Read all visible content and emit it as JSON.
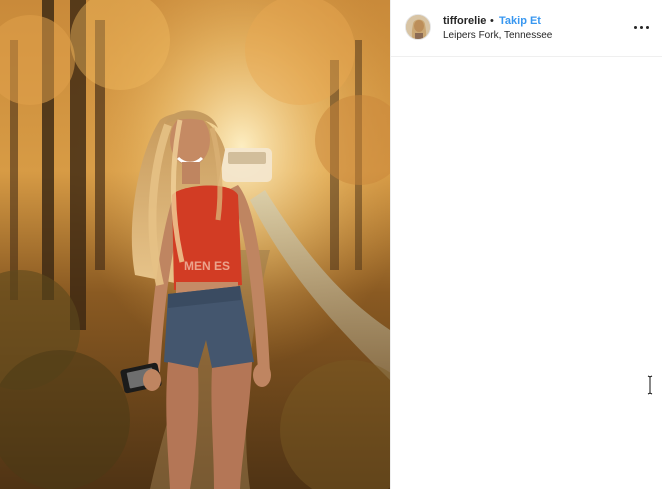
{
  "post": {
    "username": "tifforelie",
    "separator": "•",
    "follow_label": "Takip Et",
    "location": "Leipers Fork, Tennessee"
  },
  "icons": {
    "more": "more-options-icon",
    "text_cursor": "text-cursor-icon"
  },
  "colors": {
    "follow_link": "#3897f0",
    "username_text": "#262626",
    "divider": "#efefef"
  },
  "photo": {
    "shirt_text": "MEN ES"
  }
}
